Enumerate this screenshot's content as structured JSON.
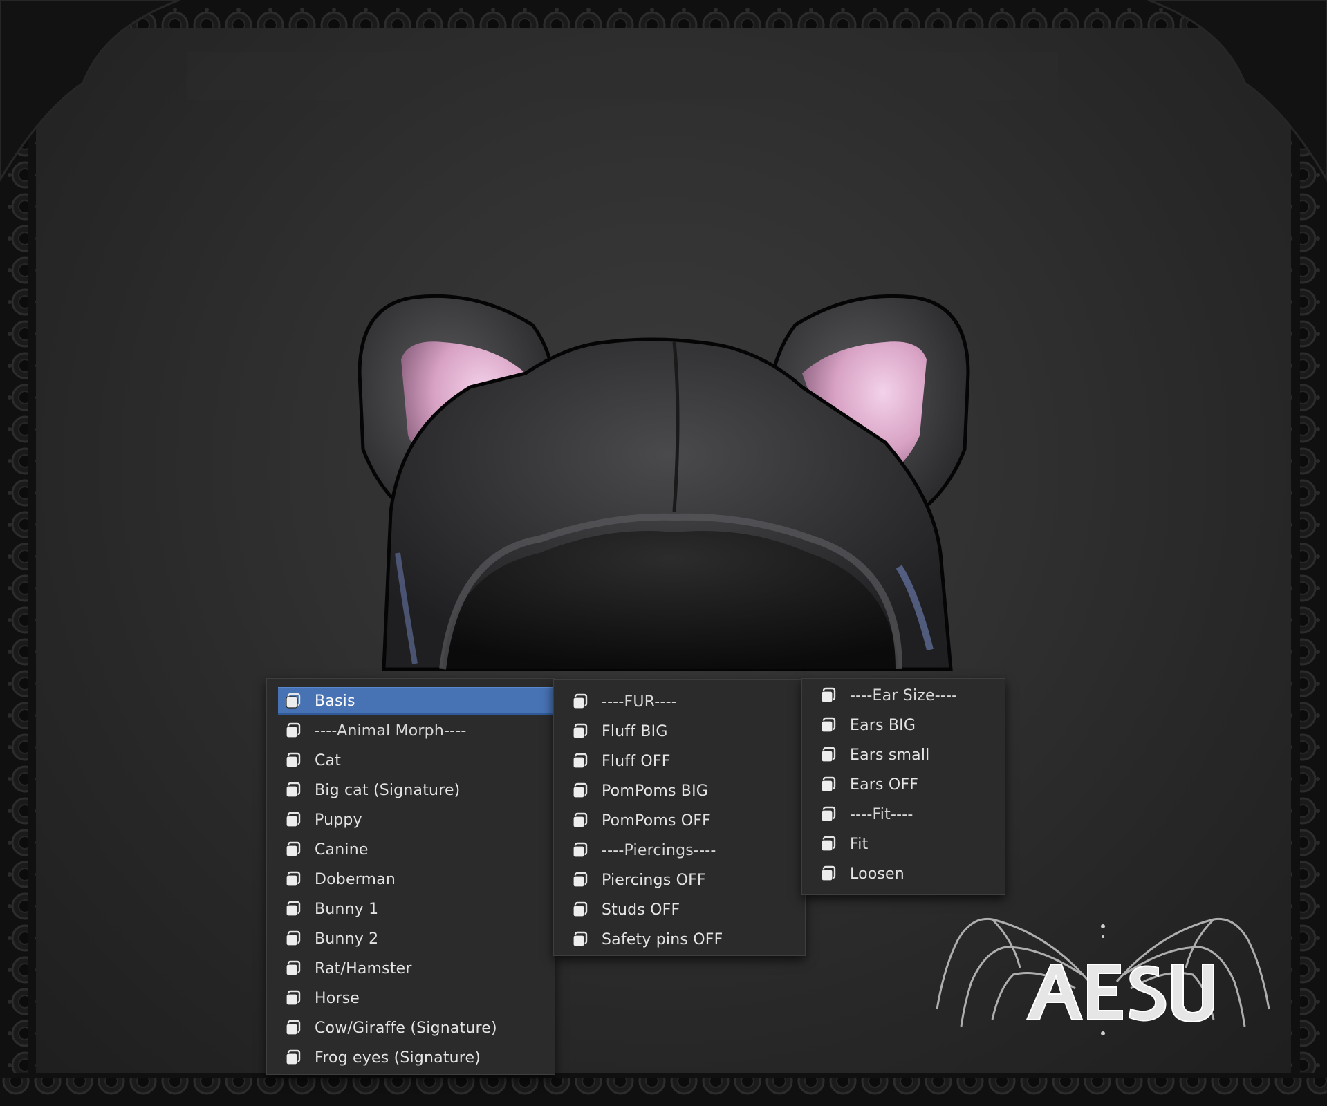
{
  "menus": {
    "left": {
      "items": [
        {
          "label": "Basis",
          "selected": true,
          "icon": "shape-key-icon"
        },
        {
          "label": "----Animal Morph----",
          "icon": "shape-key-icon"
        },
        {
          "label": "Cat",
          "icon": "shape-key-icon"
        },
        {
          "label": "Big cat (Signature)",
          "icon": "shape-key-icon"
        },
        {
          "label": "Puppy",
          "icon": "shape-key-icon"
        },
        {
          "label": "Canine",
          "icon": "shape-key-icon"
        },
        {
          "label": "Doberman",
          "icon": "shape-key-icon"
        },
        {
          "label": "Bunny 1",
          "icon": "shape-key-icon"
        },
        {
          "label": "Bunny 2",
          "icon": "shape-key-icon"
        },
        {
          "label": "Rat/Hamster",
          "icon": "shape-key-icon"
        },
        {
          "label": "Horse",
          "icon": "shape-key-icon"
        },
        {
          "label": "Cow/Giraffe (Signature)",
          "icon": "shape-key-icon"
        },
        {
          "label": "Frog eyes (Signature)",
          "icon": "shape-key-icon"
        }
      ]
    },
    "middle": {
      "items": [
        {
          "label": "----FUR----",
          "icon": "shape-key-icon"
        },
        {
          "label": "Fluff BIG",
          "icon": "shape-key-icon"
        },
        {
          "label": "Fluff OFF",
          "icon": "shape-key-icon"
        },
        {
          "label": "PomPoms BIG",
          "icon": "shape-key-icon"
        },
        {
          "label": "PomPoms OFF",
          "icon": "shape-key-icon"
        },
        {
          "label": "----Piercings----",
          "icon": "shape-key-icon"
        },
        {
          "label": "Piercings OFF",
          "icon": "shape-key-icon"
        },
        {
          "label": "Studs OFF",
          "icon": "shape-key-icon"
        },
        {
          "label": "Safety pins OFF",
          "icon": "shape-key-icon"
        }
      ]
    },
    "right": {
      "items": [
        {
          "label": "----Ear Size----",
          "icon": "shape-key-icon"
        },
        {
          "label": "Ears BIG",
          "icon": "shape-key-icon"
        },
        {
          "label": "Ears small",
          "icon": "shape-key-icon"
        },
        {
          "label": "Ears OFF",
          "icon": "shape-key-icon"
        },
        {
          "label": "----Fit----",
          "icon": "shape-key-icon"
        },
        {
          "label": "Fit",
          "icon": "shape-key-icon"
        },
        {
          "label": "Loosen",
          "icon": "shape-key-icon"
        }
      ]
    }
  },
  "logo": {
    "text": "AESU"
  },
  "colors": {
    "selection": "#4772b3",
    "menu_bg": "#2b2b2b",
    "ear_inner": "#d9a6c8",
    "hood": "#3a3a3c"
  }
}
